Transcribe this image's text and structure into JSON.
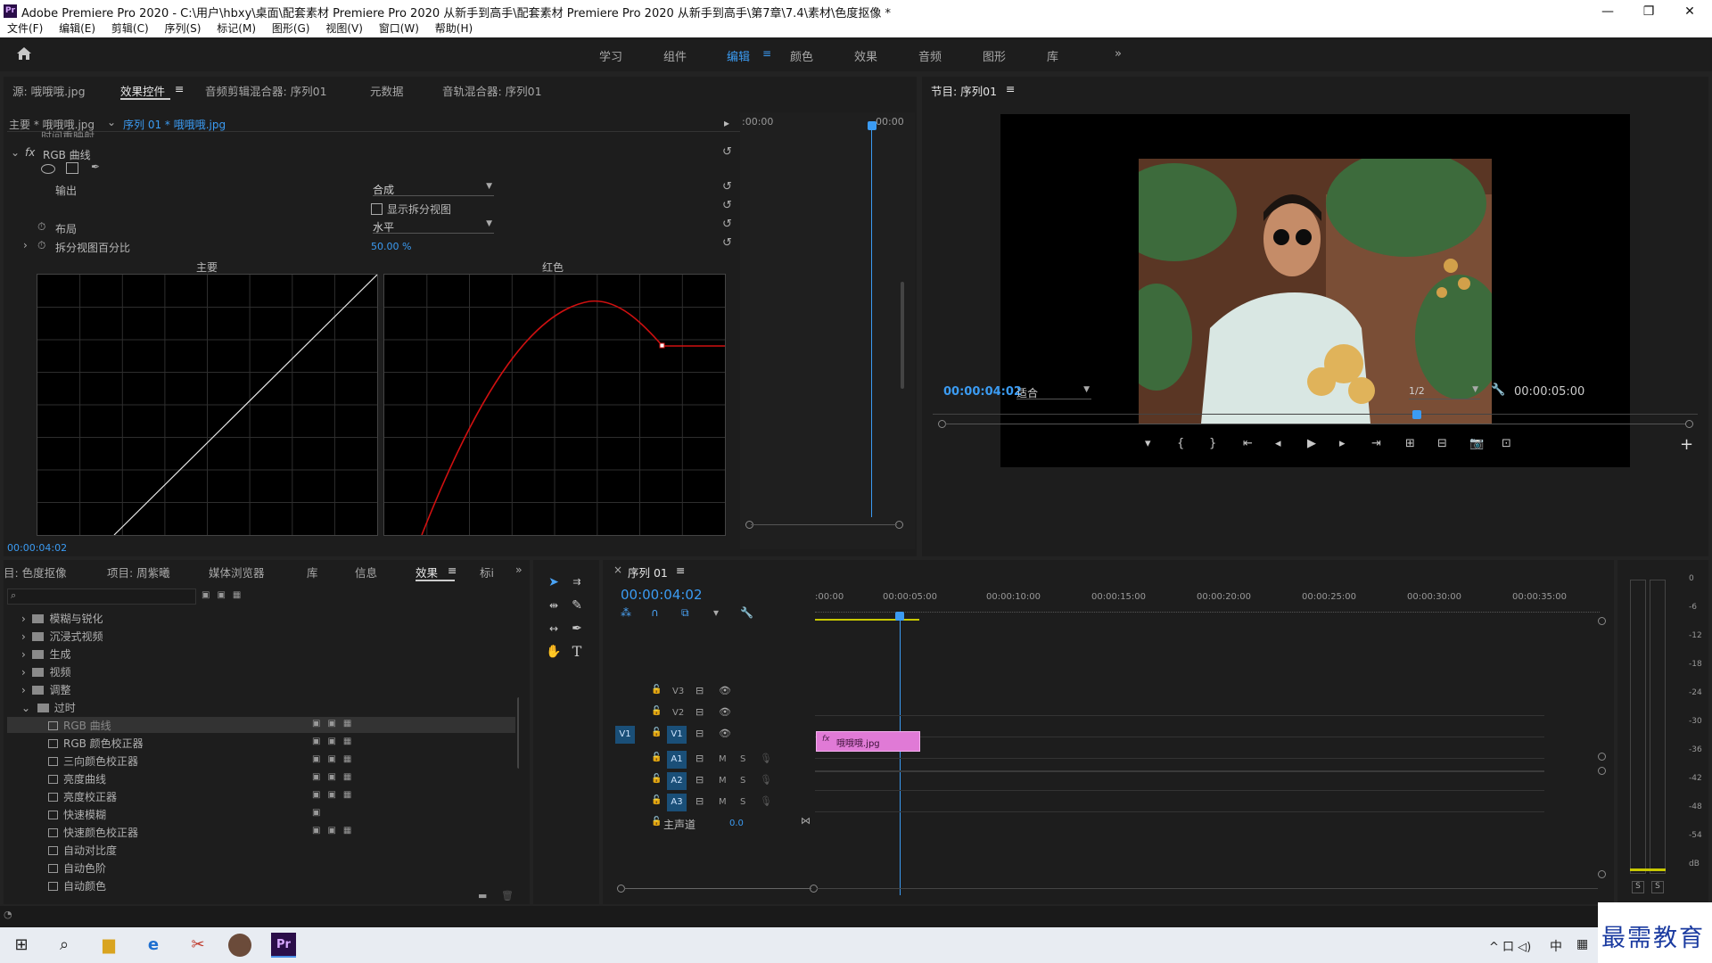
{
  "window": {
    "title": "Adobe Premiere Pro 2020 - C:\\用户\\hbxy\\桌面\\配套素材 Premiere Pro 2020 从新手到高手\\配套素材 Premiere Pro 2020 从新手到高手\\第7章\\7.4\\素材\\色度抠像 *",
    "icon": "Pr",
    "minimize": "—",
    "maximize": "❐",
    "close": "✕"
  },
  "menu": [
    "文件(F)",
    "编辑(E)",
    "剪辑(C)",
    "序列(S)",
    "标记(M)",
    "图形(G)",
    "视图(V)",
    "窗口(W)",
    "帮助(H)"
  ],
  "workspaces": [
    "学习",
    "组件",
    "编辑",
    "颜色",
    "效果",
    "音频",
    "图形",
    "库"
  ],
  "workspace_more": "»",
  "source_tabs": [
    "源: 哦哦哦.jpg",
    "效果控件",
    "音频剪辑混合器: 序列01",
    "元数据",
    "音轨混合器: 序列01"
  ],
  "effect_controls": {
    "master": "主要 * 哦哦哦.jpg",
    "sequence_clip": "序列 01 * 哦哦哦.jpg",
    "cut_label": "时间重映射",
    "effect_name": "RGB 曲线",
    "output_label": "输出",
    "output_value": "合成",
    "split_view_label": "显示拆分视图",
    "layout_label": "布局",
    "layout_value": "水平",
    "split_percent_label": "拆分视图百分比",
    "split_percent_value": "50.00 %",
    "curve_master_label": "主要",
    "curve_red_label": "红色",
    "timecode": "00:00:04:02",
    "ruler_start": ":00:00",
    "ruler_end": "00:00"
  },
  "program": {
    "title": "节目: 序列01",
    "timecode": "00:00:04:02",
    "fit": "适合",
    "quality": "1/2",
    "duration": "00:00:05:00",
    "controls": [
      "▾",
      "{",
      "}",
      "⇤",
      "◂",
      "▶",
      "▸",
      "⇥",
      "⊞",
      "⊟",
      "📷",
      "⊡"
    ],
    "add": "+"
  },
  "project": {
    "tabs": [
      "目: 色度抠像",
      "项目: 周紫曦",
      "媒体浏览器",
      "库",
      "信息",
      "效果",
      "标i"
    ],
    "more": "»",
    "search_placeholder": "",
    "folders": [
      "模糊与锐化",
      "沉浸式视频",
      "生成",
      "视频",
      "调整",
      "过时"
    ],
    "items": [
      "RGB 曲线",
      "RGB 颜色校正器",
      "三向颜色校正器",
      "亮度曲线",
      "亮度校正器",
      "快速模糊",
      "快速颜色校正器",
      "自动对比度",
      "自动色阶",
      "自动颜色"
    ]
  },
  "timeline": {
    "tab": "序列 01",
    "timecode": "00:00:04:02",
    "ruler": [
      ":00:00",
      "00:00:05:00",
      "00:00:10:00",
      "00:00:15:00",
      "00:00:20:00",
      "00:00:25:00",
      "00:00:30:00",
      "00:00:35:00"
    ],
    "video_tracks": [
      "V3",
      "V2",
      "V1"
    ],
    "audio_tracks": [
      "A1",
      "A2",
      "A3"
    ],
    "source_patch_v": "V1",
    "master": "主声道",
    "master_value": "0.0",
    "clip_name": "哦哦哦.jpg",
    "clip_fx": "fx",
    "mute": "M",
    "solo": "S"
  },
  "meter": {
    "scale": [
      "0",
      "-6",
      "-12",
      "-18",
      "-24",
      "-30",
      "-36",
      "-42",
      "-48",
      "-54",
      "dB"
    ],
    "solo_left": "S",
    "solo_right": "S"
  },
  "watermark": "最需教育",
  "taskbar": {
    "ime": "中",
    "tray": "^ 口 ◁) "
  }
}
